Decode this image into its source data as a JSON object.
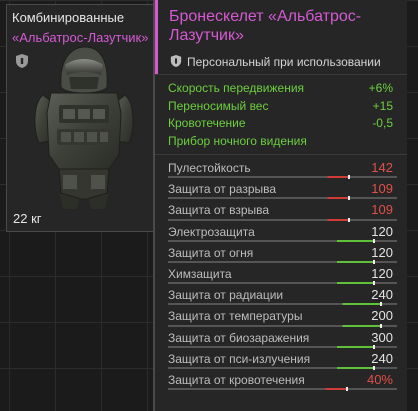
{
  "card": {
    "category": "Комбинированные",
    "name": "«Альбатрос-Лазутчик»",
    "weight": "22 кг",
    "icons": {
      "badge": "shield-icon",
      "image": "exoskeleton-armor-image"
    }
  },
  "tooltip": {
    "title": "Бронескелет «Альбатрос-Лазутчик»",
    "personal_use": "Персональный при использовании",
    "icons": {
      "badge": "shield-icon"
    },
    "bonuses": [
      {
        "label": "Скорость передвижения",
        "value": "+6%"
      },
      {
        "label": "Переносимый вес",
        "value": "+15"
      },
      {
        "label": "Кровотечение",
        "value": "-0,5"
      },
      {
        "label": "Прибор ночного видения",
        "value": ""
      }
    ],
    "stats": [
      {
        "label": "Пулестойкость",
        "value": "142",
        "level": 0.79,
        "status": "low"
      },
      {
        "label": "Защита от разрыва",
        "value": "109",
        "level": 0.79,
        "status": "low"
      },
      {
        "label": "Защита от взрыва",
        "value": "109",
        "level": 0.79,
        "status": "low"
      },
      {
        "label": "Электрозащита",
        "value": "120",
        "level": 0.9,
        "status": "ok"
      },
      {
        "label": "Защита от огня",
        "value": "120",
        "level": 0.9,
        "status": "ok"
      },
      {
        "label": "Химзащита",
        "value": "120",
        "level": 0.9,
        "status": "ok"
      },
      {
        "label": "Защита от радиации",
        "value": "240",
        "level": 0.93,
        "status": "ok"
      },
      {
        "label": "Защита от температуры",
        "value": "200",
        "level": 0.93,
        "status": "ok"
      },
      {
        "label": "Защита от биозаражения",
        "value": "300",
        "level": 0.9,
        "status": "ok"
      },
      {
        "label": "Защита от пси-излучения",
        "value": "240",
        "level": 0.9,
        "status": "ok"
      },
      {
        "label": "Защита от кровотечения",
        "value": "40%",
        "level": 0.78,
        "status": "low"
      }
    ]
  },
  "colors": {
    "rarity": "#d35ad3",
    "bonus": "#6ccf3f",
    "stat_ok": "#e4e4e4",
    "stat_low": "#e0504a",
    "bar_ok": "#5fc23a",
    "bar_low": "#d23c36",
    "bar_track": "#555555"
  }
}
